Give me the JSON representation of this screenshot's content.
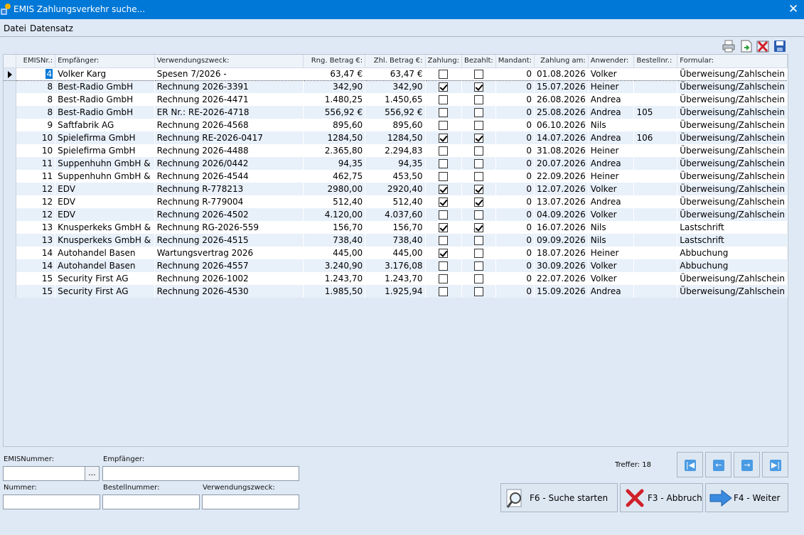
{
  "window": {
    "title": "EMIS Zahlungsverkehr suche...",
    "close_glyph": "✕"
  },
  "menu": [
    "Datei",
    "Datensatz"
  ],
  "toolbar": [
    "printer-icon",
    "export-icon",
    "delete-icon",
    "save-icon"
  ],
  "columns": [
    "EMISNr.:",
    "Empfänger:",
    "Verwendungszweck:",
    "Rng. Betrag €:",
    "Zhl. Betrag €:",
    "Zahlung:",
    "Bezahlt:",
    "Mandant:",
    "Zahlung am:",
    "Anwender:",
    "Bestellnr.:",
    "Formular:"
  ],
  "rows": [
    {
      "emisnr": "4",
      "empf": "Volker Karg",
      "zweck": "Spesen 7/2026 -",
      "rng": "63,47 €",
      "zhl": "63,47 €",
      "zahlung": false,
      "bezahlt": false,
      "mandant": "0",
      "datum": "01.08.2026",
      "anwender": "Volker",
      "bestell": "",
      "formular": "Überweisung/Zahlschein"
    },
    {
      "emisnr": "8",
      "empf": "Best-Radio GmbH",
      "zweck": "Rechnung 2026-3391",
      "rng": "342,90",
      "zhl": "342,90",
      "zahlung": true,
      "bezahlt": true,
      "mandant": "0",
      "datum": "15.07.2026",
      "anwender": "Heiner",
      "bestell": "",
      "formular": "Überweisung/Zahlschein"
    },
    {
      "emisnr": "8",
      "empf": "Best-Radio GmbH",
      "zweck": "Rechnung 2026-4471",
      "rng": "1.480,25",
      "zhl": "1.450,65",
      "zahlung": false,
      "bezahlt": false,
      "mandant": "0",
      "datum": "26.08.2026",
      "anwender": "Andrea",
      "bestell": "",
      "formular": "Überweisung/Zahlschein"
    },
    {
      "emisnr": "8",
      "empf": "Best-Radio GmbH",
      "zweck": "ER Nr.: RE-2026-4718",
      "rng": "556,92 €",
      "zhl": "556,92 €",
      "zahlung": false,
      "bezahlt": false,
      "mandant": "0",
      "datum": "25.08.2026",
      "anwender": "Andrea",
      "bestell": "105",
      "formular": "Überweisung/Zahlschein"
    },
    {
      "emisnr": "9",
      "empf": "Saftfabrik AG",
      "zweck": "Rechnung 2026-4568",
      "rng": "895,60",
      "zhl": "895,60",
      "zahlung": false,
      "bezahlt": false,
      "mandant": "0",
      "datum": "06.10.2026",
      "anwender": "Nils",
      "bestell": "",
      "formular": "Überweisung/Zahlschein"
    },
    {
      "emisnr": "10",
      "empf": "Spielefirma GmbH",
      "zweck": "Rechnung RE-2026-0417",
      "rng": "1284,50",
      "zhl": "1284,50",
      "zahlung": true,
      "bezahlt": true,
      "mandant": "0",
      "datum": "14.07.2026",
      "anwender": "Andrea",
      "bestell": "106",
      "formular": "Überweisung/Zahlschein"
    },
    {
      "emisnr": "10",
      "empf": "Spielefirma GmbH",
      "zweck": "Rechnung 2026-4488",
      "rng": "2.365,80",
      "zhl": "2.294,83",
      "zahlung": false,
      "bezahlt": false,
      "mandant": "0",
      "datum": "31.08.2026",
      "anwender": "Heiner",
      "bestell": "",
      "formular": "Überweisung/Zahlschein"
    },
    {
      "emisnr": "11",
      "empf": "Suppenhuhn GmbH &",
      "zweck": "Rechnung 2026/0442",
      "rng": "94,35",
      "zhl": "94,35",
      "zahlung": false,
      "bezahlt": false,
      "mandant": "0",
      "datum": "20.07.2026",
      "anwender": "Andrea",
      "bestell": "",
      "formular": "Überweisung/Zahlschein"
    },
    {
      "emisnr": "11",
      "empf": "Suppenhuhn GmbH &",
      "zweck": "Rechnung 2026-4544",
      "rng": "462,75",
      "zhl": "453,50",
      "zahlung": false,
      "bezahlt": false,
      "mandant": "0",
      "datum": "22.09.2026",
      "anwender": "Heiner",
      "bestell": "",
      "formular": "Überweisung/Zahlschein"
    },
    {
      "emisnr": "12",
      "empf": "EDV",
      "zweck": "Rechnung R-778213",
      "rng": "2980,00",
      "zhl": "2920,40",
      "zahlung": true,
      "bezahlt": true,
      "mandant": "0",
      "datum": "12.07.2026",
      "anwender": "Volker",
      "bestell": "",
      "formular": "Überweisung/Zahlschein"
    },
    {
      "emisnr": "12",
      "empf": "EDV",
      "zweck": "Rechnung R-779004",
      "rng": "512,40",
      "zhl": "512,40",
      "zahlung": true,
      "bezahlt": true,
      "mandant": "0",
      "datum": "13.07.2026",
      "anwender": "Andrea",
      "bestell": "",
      "formular": "Überweisung/Zahlschein"
    },
    {
      "emisnr": "12",
      "empf": "EDV",
      "zweck": "Rechnung 2026-4502",
      "rng": "4.120,00",
      "zhl": "4.037,60",
      "zahlung": false,
      "bezahlt": false,
      "mandant": "0",
      "datum": "04.09.2026",
      "anwender": "Volker",
      "bestell": "",
      "formular": "Überweisung/Zahlschein"
    },
    {
      "emisnr": "13",
      "empf": "Knusperkeks GmbH &",
      "zweck": "Rechnung RG-2026-559",
      "rng": "156,70",
      "zhl": "156,70",
      "zahlung": true,
      "bezahlt": true,
      "mandant": "0",
      "datum": "16.07.2026",
      "anwender": "Nils",
      "bestell": "",
      "formular": "Lastschrift"
    },
    {
      "emisnr": "13",
      "empf": "Knusperkeks GmbH &",
      "zweck": "Rechnung 2026-4515",
      "rng": "738,40",
      "zhl": "738,40",
      "zahlung": false,
      "bezahlt": false,
      "mandant": "0",
      "datum": "09.09.2026",
      "anwender": "Nils",
      "bestell": "",
      "formular": "Lastschrift"
    },
    {
      "emisnr": "14",
      "empf": "Autohandel Basen",
      "zweck": "Wartungsvertrag 2026",
      "rng": "445,00",
      "zhl": "445,00",
      "zahlung": true,
      "bezahlt": false,
      "mandant": "0",
      "datum": "18.07.2026",
      "anwender": "Heiner",
      "bestell": "",
      "formular": "Abbuchung"
    },
    {
      "emisnr": "14",
      "empf": "Autohandel Basen",
      "zweck": "Rechnung 2026-4557",
      "rng": "3.240,90",
      "zhl": "3.176,08",
      "zahlung": false,
      "bezahlt": false,
      "mandant": "0",
      "datum": "30.09.2026",
      "anwender": "Volker",
      "bestell": "",
      "formular": "Abbuchung"
    },
    {
      "emisnr": "15",
      "empf": "Security First AG",
      "zweck": "Rechnung 2026-1002",
      "rng": "1.243,70",
      "zhl": "1.243,70",
      "zahlung": false,
      "bezahlt": false,
      "mandant": "0",
      "datum": "22.07.2026",
      "anwender": "Volker",
      "bestell": "",
      "formular": "Überweisung/Zahlschein"
    },
    {
      "emisnr": "15",
      "empf": "Security First AG",
      "zweck": "Rechnung 2026-4530",
      "rng": "1.985,50",
      "zhl": "1.925,94",
      "zahlung": false,
      "bezahlt": false,
      "mandant": "0",
      "datum": "15.09.2026",
      "anwender": "Andrea",
      "bestell": "",
      "formular": "Überweisung/Zahlschein"
    }
  ],
  "search": {
    "emis_label": "EMISNummer:",
    "emis_value": "",
    "dots": "...",
    "empf_label": "Empfänger:",
    "empf_value": "",
    "nummer_label": "Nummer:",
    "nummer_value": "",
    "bestell_label": "Bestellnummer:",
    "bestell_value": "",
    "zweck_label": "Verwendungszweck:",
    "zweck_value": ""
  },
  "treffer": "Treffer: 18",
  "buttons": {
    "search": "F6 - Suche starten",
    "cancel": "F3 - Abbruch",
    "next": "F4 - Weiter"
  }
}
